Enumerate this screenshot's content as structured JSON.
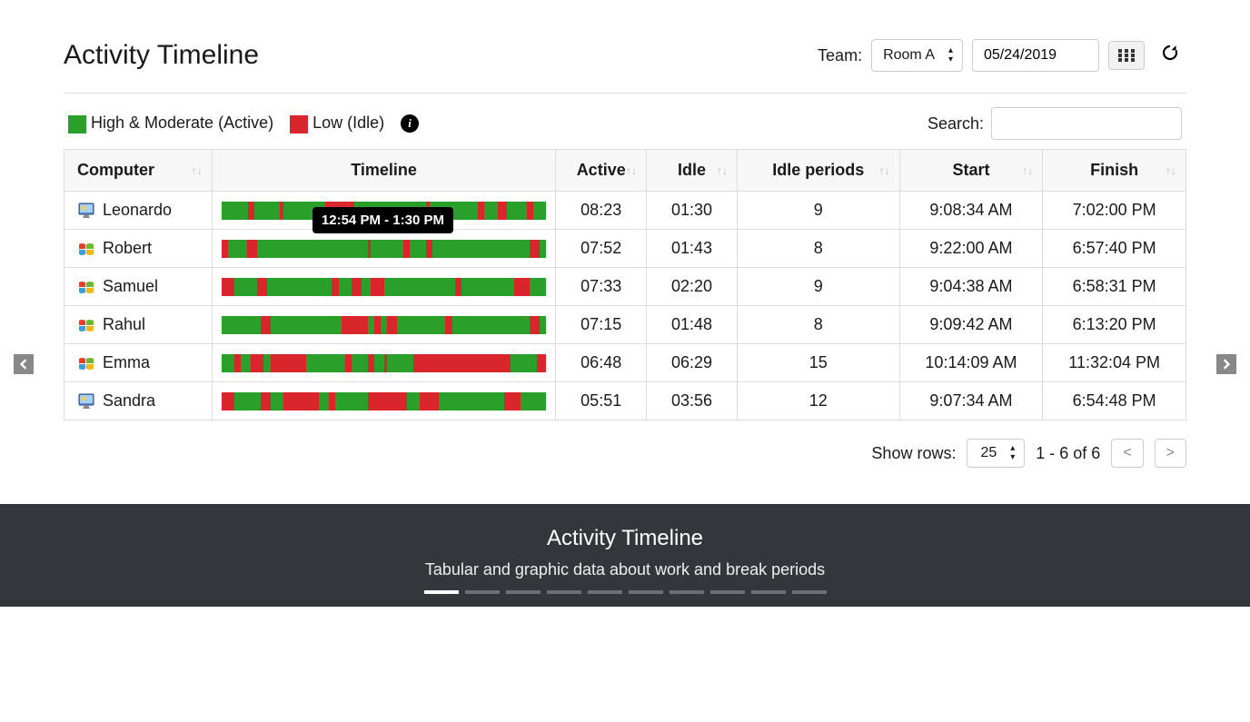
{
  "header": {
    "title": "Activity Timeline",
    "team_label": "Team:",
    "team_value": "Room A",
    "date_value": "05/24/2019"
  },
  "legend": {
    "active_label": "High & Moderate (Active)",
    "idle_label": "Low (Idle)"
  },
  "search": {
    "label": "Search:",
    "value": ""
  },
  "columns": {
    "computer": "Computer",
    "timeline": "Timeline",
    "active": "Active",
    "idle": "Idle",
    "idle_periods": "Idle periods",
    "start": "Start",
    "finish": "Finish"
  },
  "tooltip": "12:54 PM - 1:30 PM",
  "rows": [
    {
      "os": "mac",
      "name": "Leonardo",
      "active": "08:23",
      "idle": "01:30",
      "periods": "9",
      "start": "9:08:34 AM",
      "finish": "7:02:00 PM",
      "segments": [
        [
          "g",
          8
        ],
        [
          "r",
          2
        ],
        [
          "g",
          8
        ],
        [
          "r",
          1
        ],
        [
          "g",
          13
        ],
        [
          "r",
          9
        ],
        [
          "g",
          22
        ],
        [
          "r",
          1
        ],
        [
          "g",
          15
        ],
        [
          "r",
          2
        ],
        [
          "g",
          4
        ],
        [
          "r",
          3
        ],
        [
          "g",
          6
        ],
        [
          "r",
          2
        ],
        [
          "g",
          4
        ]
      ]
    },
    {
      "os": "win",
      "name": "Robert",
      "active": "07:52",
      "idle": "01:43",
      "periods": "8",
      "start": "9:22:00 AM",
      "finish": "6:57:40 PM",
      "segments": [
        [
          "r",
          2
        ],
        [
          "g",
          6
        ],
        [
          "r",
          3
        ],
        [
          "g",
          34
        ],
        [
          "r",
          1
        ],
        [
          "g",
          10
        ],
        [
          "r",
          2
        ],
        [
          "g",
          5
        ],
        [
          "r",
          2
        ],
        [
          "g",
          30
        ],
        [
          "r",
          3
        ],
        [
          "g",
          2
        ]
      ]
    },
    {
      "os": "win",
      "name": "Samuel",
      "active": "07:33",
      "idle": "02:20",
      "periods": "9",
      "start": "9:04:38 AM",
      "finish": "6:58:31 PM",
      "segments": [
        [
          "r",
          4
        ],
        [
          "g",
          7
        ],
        [
          "r",
          3
        ],
        [
          "g",
          20
        ],
        [
          "r",
          2
        ],
        [
          "g",
          4
        ],
        [
          "r",
          3
        ],
        [
          "g",
          3
        ],
        [
          "r",
          4
        ],
        [
          "g",
          22
        ],
        [
          "r",
          2
        ],
        [
          "g",
          16
        ],
        [
          "r",
          5
        ],
        [
          "g",
          5
        ]
      ]
    },
    {
      "os": "win",
      "name": "Rahul",
      "active": "07:15",
      "idle": "01:48",
      "periods": "8",
      "start": "9:09:42 AM",
      "finish": "6:13:20 PM",
      "segments": [
        [
          "g",
          12
        ],
        [
          "r",
          3
        ],
        [
          "g",
          22
        ],
        [
          "r",
          8
        ],
        [
          "g",
          2
        ],
        [
          "r",
          2
        ],
        [
          "g",
          2
        ],
        [
          "r",
          3
        ],
        [
          "g",
          15
        ],
        [
          "r",
          2
        ],
        [
          "g",
          24
        ],
        [
          "r",
          3
        ],
        [
          "g",
          2
        ]
      ]
    },
    {
      "os": "win",
      "name": "Emma",
      "active": "06:48",
      "idle": "06:29",
      "periods": "15",
      "start": "10:14:09 AM",
      "finish": "11:32:04 PM",
      "segments": [
        [
          "g",
          4
        ],
        [
          "r",
          2
        ],
        [
          "g",
          3
        ],
        [
          "r",
          4
        ],
        [
          "g",
          2
        ],
        [
          "r",
          11
        ],
        [
          "g",
          12
        ],
        [
          "r",
          2
        ],
        [
          "g",
          5
        ],
        [
          "r",
          2
        ],
        [
          "g",
          3
        ],
        [
          "r",
          1
        ],
        [
          "g",
          8
        ],
        [
          "r",
          30
        ],
        [
          "g",
          8
        ],
        [
          "r",
          3
        ]
      ]
    },
    {
      "os": "mac",
      "name": "Sandra",
      "active": "05:51",
      "idle": "03:56",
      "periods": "12",
      "start": "9:07:34 AM",
      "finish": "6:54:48 PM",
      "segments": [
        [
          "r",
          4
        ],
        [
          "g",
          8
        ],
        [
          "r",
          3
        ],
        [
          "g",
          4
        ],
        [
          "r",
          11
        ],
        [
          "g",
          3
        ],
        [
          "r",
          2
        ],
        [
          "g",
          10
        ],
        [
          "r",
          12
        ],
        [
          "g",
          4
        ],
        [
          "r",
          6
        ],
        [
          "g",
          20
        ],
        [
          "r",
          5
        ],
        [
          "g",
          8
        ]
      ]
    }
  ],
  "pagination": {
    "show_rows_label": "Show rows:",
    "show_rows_value": "25",
    "range": "1 - 6 of 6"
  },
  "caption": {
    "title": "Activity Timeline",
    "subtitle": "Tabular and graphic data about work and break periods",
    "dot_count": 10,
    "active_dot": 0
  },
  "chart_data": {
    "type": "table",
    "title": "Activity Timeline",
    "legend": {
      "green": "High & Moderate (Active)",
      "red": "Low (Idle)"
    },
    "columns": [
      "Computer",
      "Active",
      "Idle",
      "Idle periods",
      "Start",
      "Finish"
    ],
    "rows": [
      [
        "Leonardo",
        "08:23",
        "01:30",
        9,
        "9:08:34 AM",
        "7:02:00 PM"
      ],
      [
        "Robert",
        "07:52",
        "01:43",
        8,
        "9:22:00 AM",
        "6:57:40 PM"
      ],
      [
        "Samuel",
        "07:33",
        "02:20",
        9,
        "9:04:38 AM",
        "6:58:31 PM"
      ],
      [
        "Rahul",
        "07:15",
        "01:48",
        8,
        "9:09:42 AM",
        "6:13:20 PM"
      ],
      [
        "Emma",
        "06:48",
        "06:29",
        15,
        "10:14:09 AM",
        "11:32:04 PM"
      ],
      [
        "Sandra",
        "05:51",
        "03:56",
        12,
        "9:07:34 AM",
        "6:54:48 PM"
      ]
    ],
    "tooltip_example": "12:54 PM - 1:30 PM"
  }
}
